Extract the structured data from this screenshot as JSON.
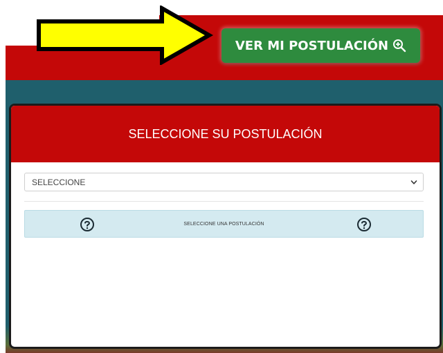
{
  "header": {
    "view_button_label": "VER MI POSTULACIÓN"
  },
  "icons": {
    "view_button_icon": "zoom-in-icon",
    "select_icon": "chevron-down-icon",
    "help_icon": "question-circle-icon",
    "annotation": "arrow-icon"
  },
  "colors": {
    "brand_red": "#c40808",
    "button_green": "#2e8b3e",
    "arrow_yellow": "#ffff00",
    "info_bg": "#d4eaf0",
    "backdrop_teal": "#1f5f6c"
  },
  "modal": {
    "title": "SELECCIONE SU POSTULACIÓN",
    "select": {
      "selected_value": "SELECCIONE"
    },
    "info": {
      "message": "SELECCIONE UNA POSTULACIÓN"
    }
  }
}
